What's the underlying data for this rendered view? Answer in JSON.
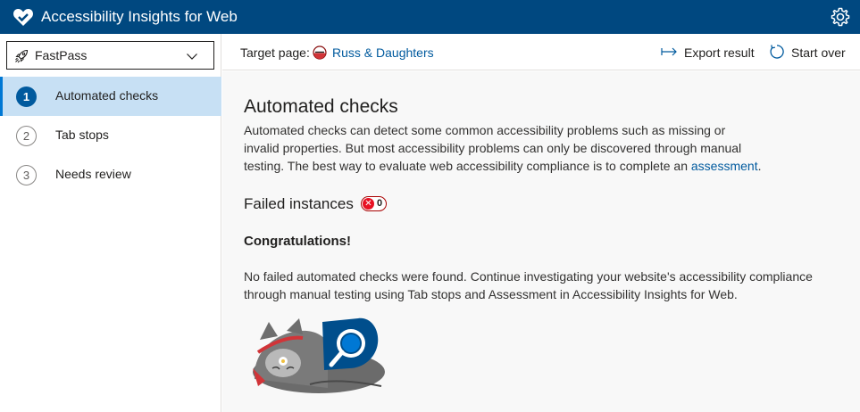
{
  "titlebar": {
    "app_title": "Accessibility Insights for Web",
    "logo_icon": "heart-logo-icon",
    "settings_icon": "gear-icon"
  },
  "sidebar": {
    "mode_selector": {
      "value": "FastPass",
      "icon": "rocket-icon"
    },
    "items": [
      {
        "number": "1",
        "label": "Automated checks",
        "active": true
      },
      {
        "number": "2",
        "label": "Tab stops",
        "active": false
      },
      {
        "number": "3",
        "label": "Needs review",
        "active": false
      }
    ]
  },
  "commandbar": {
    "target_label": "Target page:",
    "target_link": "Russ & Daughters",
    "export_label": "Export result",
    "start_over_label": "Start over"
  },
  "content": {
    "title": "Automated checks",
    "description_prefix": "Automated checks can detect some common accessibility problems such as missing or invalid properties. But most accessibility problems can only be discovered through manual testing. The best way to evaluate web accessibility compliance is to complete an ",
    "description_link": "assessment",
    "description_suffix": ".",
    "failed_title": "Failed instances",
    "failed_count": "0",
    "congrats": "Congratulations!",
    "message": "No failed automated checks were found. Continue investigating your website's accessibility compliance through manual testing using Tab stops and Assessment in Accessibility Insights for Web."
  },
  "colors": {
    "titlebar": "#004880",
    "accent": "#0078d4",
    "active_nav": "#c7e0f4",
    "link": "#005a9e",
    "error": "#e81123"
  }
}
